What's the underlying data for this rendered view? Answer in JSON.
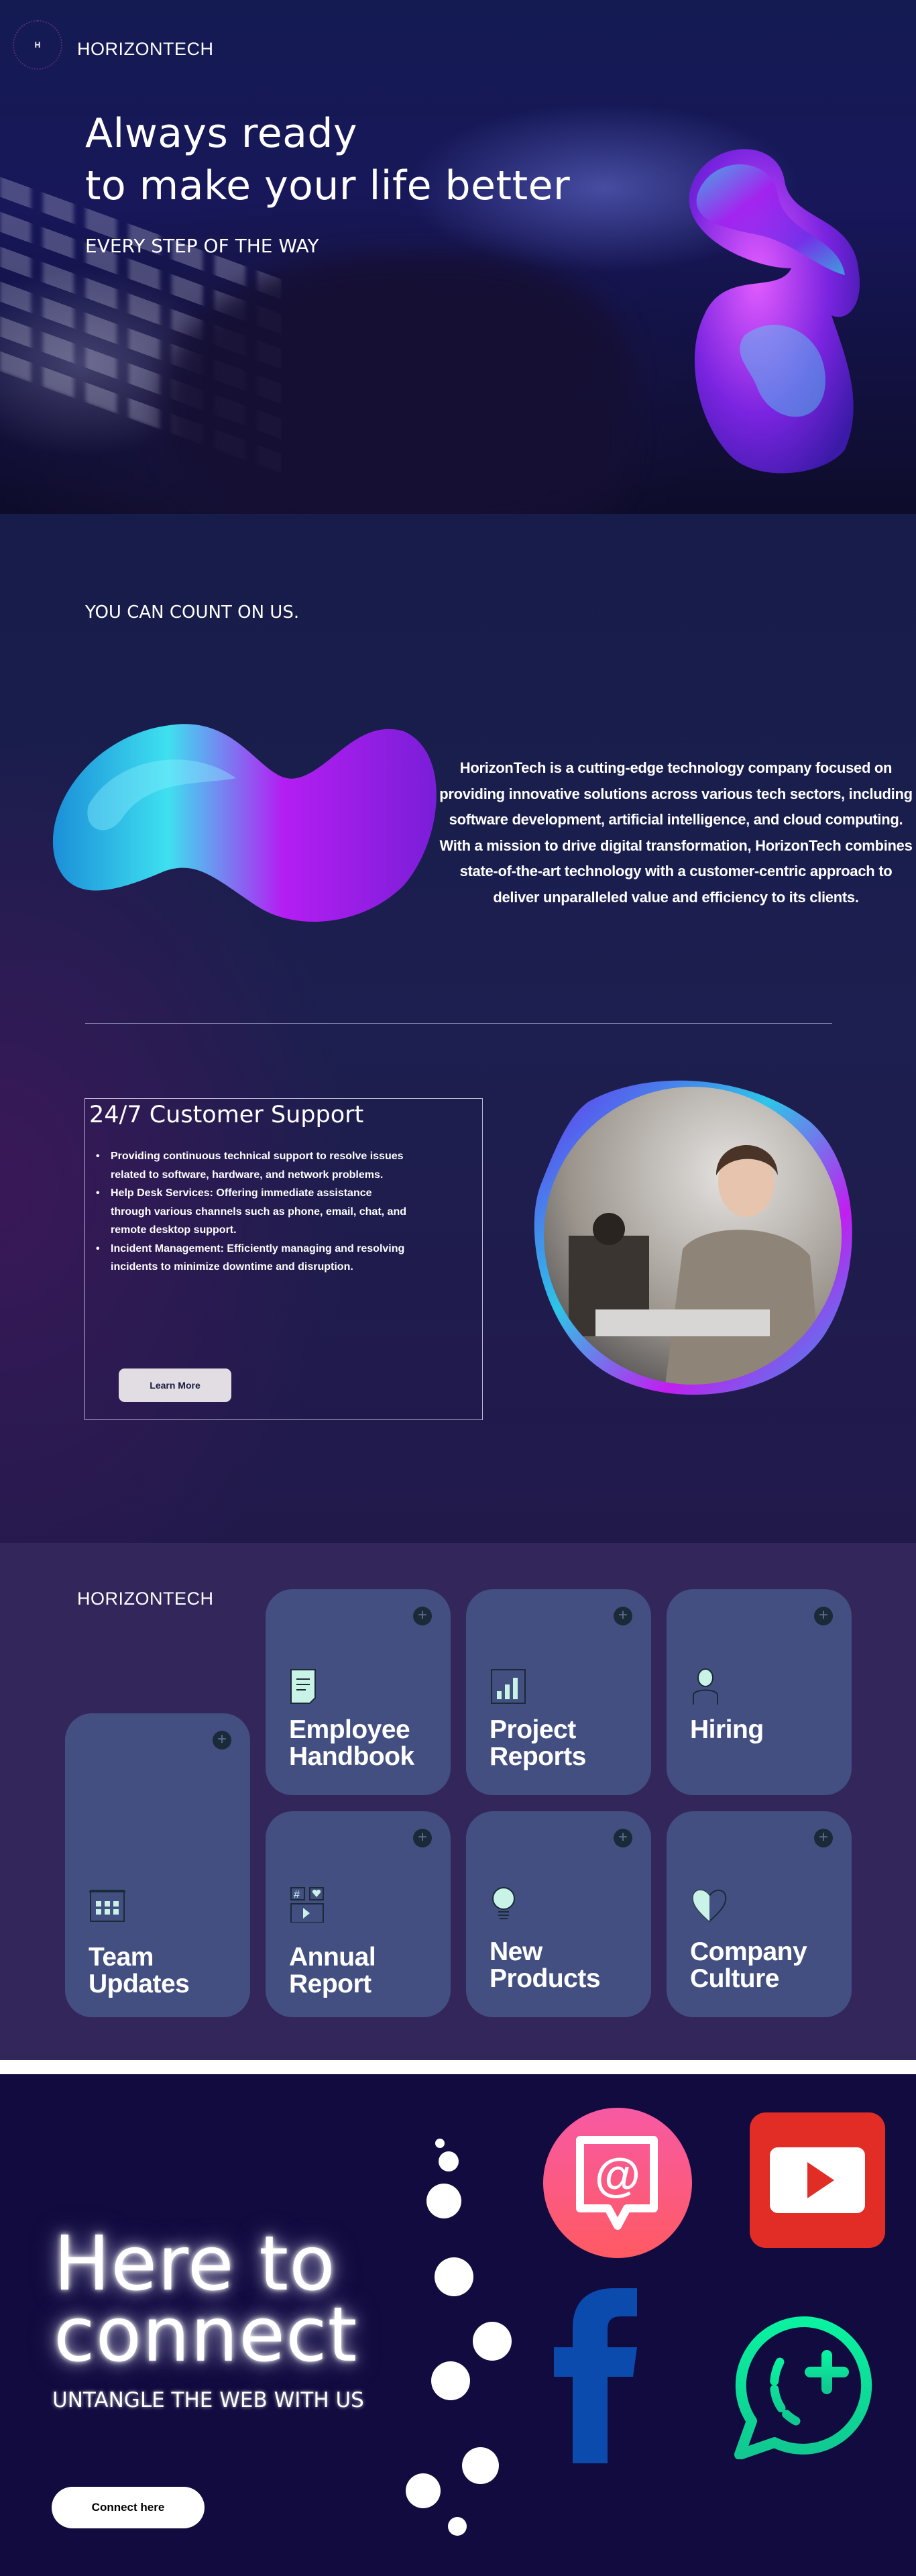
{
  "hero": {
    "logo_letter": "H",
    "brand": "HORIZONTECH",
    "headline_line1": "Always ready",
    "headline_line2": "to make your life better",
    "subheadline": "EVERY STEP OF THE WAY"
  },
  "about": {
    "eyebrow": "YOU CAN COUNT ON US.",
    "description": "HorizonTech is a cutting-edge technology company focused on providing innovative solutions across various tech sectors, including software development, artificial intelligence, and cloud computing. With a mission to drive digital transformation, HorizonTech combines state-of-the-art technology with a customer-centric approach to deliver unparalleled value and efficiency to its clients."
  },
  "support": {
    "title": "24/7 Customer Support",
    "bullets": [
      "Providing continuous technical support to resolve issues related to software, hardware, and network problems.",
      "Help Desk Services: Offering immediate assistance through various channels such as phone, email, chat, and remote desktop support.",
      "Incident Management: Efficiently managing and resolving incidents to minimize downtime and disruption."
    ],
    "button_label": "Learn More"
  },
  "resources": {
    "brand": "HORIZONTECH",
    "cards": [
      {
        "label": "Team Updates",
        "icon": "calendar-icon"
      },
      {
        "label": "Employee Handbook",
        "icon": "document-icon"
      },
      {
        "label": "Project Reports",
        "icon": "bar-chart-icon"
      },
      {
        "label": "Hiring",
        "icon": "person-icon"
      },
      {
        "label": "Annual Report",
        "icon": "media-grid-icon"
      },
      {
        "label": "New Products",
        "icon": "lightbulb-icon"
      },
      {
        "label": "Company Culture",
        "icon": "heart-icon"
      }
    ]
  },
  "connect": {
    "headline_line1": "Here to",
    "headline_line2": "connect",
    "tagline": "UNTANGLE THE WEB WITH US",
    "button_label": "Connect here",
    "social": [
      "email-mention-icon",
      "youtube-icon",
      "facebook-icon",
      "whatsapp-icon"
    ]
  },
  "colors": {
    "card_bg": "#424f80",
    "section3_bg": "#33265a",
    "section4_bg": "#110b3f",
    "icon_mint": "#c8f3e6",
    "like_blue": "#2f6fe0",
    "youtube_red": "#e22d26",
    "facebook_blue": "#0a4bad",
    "whatsapp_green": "#0ad99a"
  }
}
